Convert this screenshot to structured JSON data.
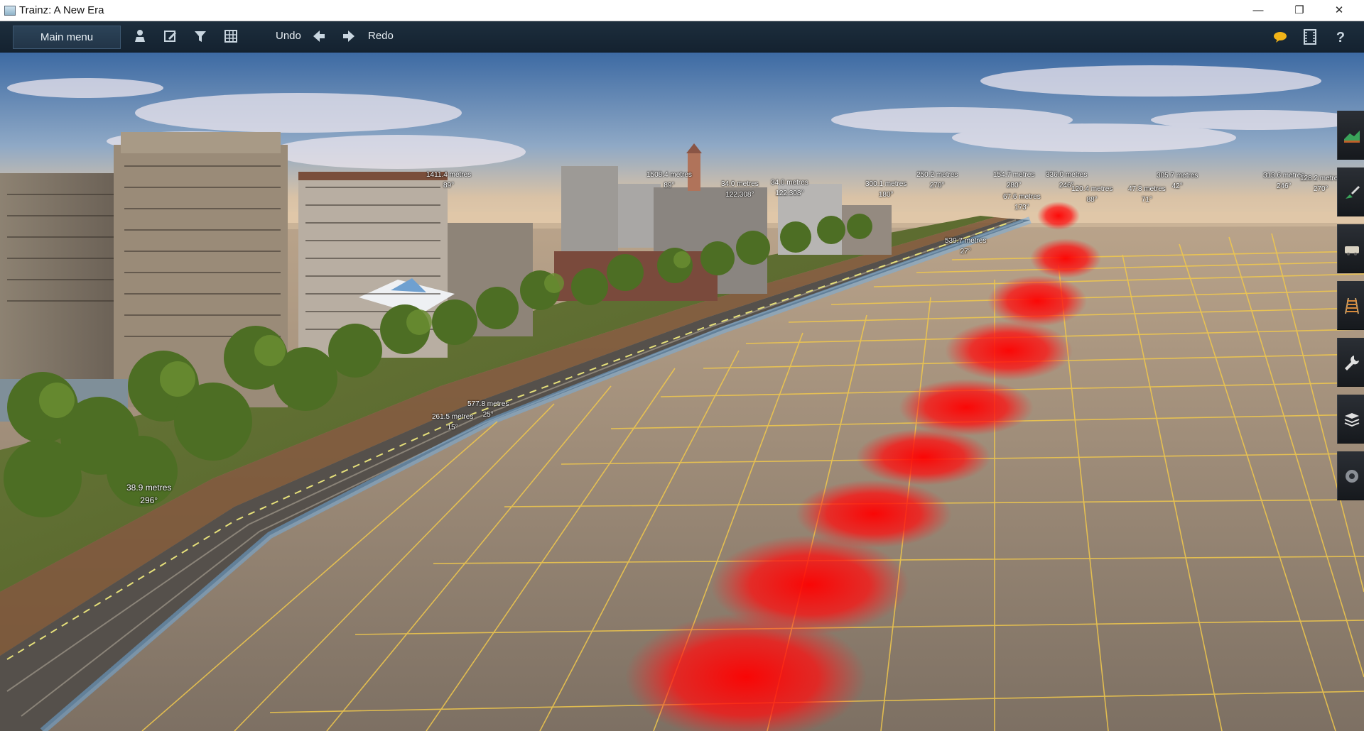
{
  "window": {
    "title": "Trainz: A New Era",
    "controls": {
      "minimize": "—",
      "maximize": "❐",
      "close": "✕"
    }
  },
  "toolbar": {
    "main_menu": "Main menu",
    "left_icons": [
      "person-icon",
      "edit-icon",
      "filter-icon",
      "grid-icon"
    ],
    "undo_label": "Undo",
    "redo_label": "Redo",
    "right_icons": [
      "chat-icon",
      "film-icon",
      "help-icon"
    ],
    "help_glyph": "?"
  },
  "tool_strip": [
    "topology-tool-icon",
    "paint-tool-icon",
    "objects-tool-icon",
    "track-tool-icon",
    "tools-wrench-icon",
    "layers-icon",
    "settings-icon"
  ],
  "measurements": [
    {
      "distance": "1411.4 metres",
      "angle": "89°"
    },
    {
      "distance": "1508.4 metres",
      "angle": "89°"
    },
    {
      "distance": "34.0 metres",
      "angle": "122.308°"
    },
    {
      "distance": "34.0 metres",
      "angle": "122.308°"
    },
    {
      "distance": "300.1 metres",
      "angle": "180°"
    },
    {
      "distance": "250.2 metres",
      "angle": "270°"
    },
    {
      "distance": "154.7 metres",
      "angle": "280°"
    },
    {
      "distance": "336.0 metres",
      "angle": "246°"
    },
    {
      "distance": "120.4 metres",
      "angle": "88°"
    },
    {
      "distance": "47.8 metres",
      "angle": "71°"
    },
    {
      "distance": "305.7 metres",
      "angle": "42°"
    },
    {
      "distance": "313.6 metres",
      "angle": "246°"
    },
    {
      "distance": "128.2 metres",
      "angle": "270°"
    },
    {
      "distance": "67.6 metres",
      "angle": "173°"
    },
    {
      "distance": "539.7 metres",
      "angle": "27°"
    },
    {
      "distance": "577.8 metres",
      "angle": "25°"
    },
    {
      "distance": "261.5 metres",
      "angle": "15°"
    },
    {
      "distance": "38.9 metres",
      "angle": "296°"
    }
  ],
  "colors": {
    "toolbar_bg": "#1a2a39",
    "grid_line": "#f2c94c",
    "terrain": "#8f8375",
    "highlight": "#ff1a1a",
    "sky_top": "#3f6ea8"
  }
}
